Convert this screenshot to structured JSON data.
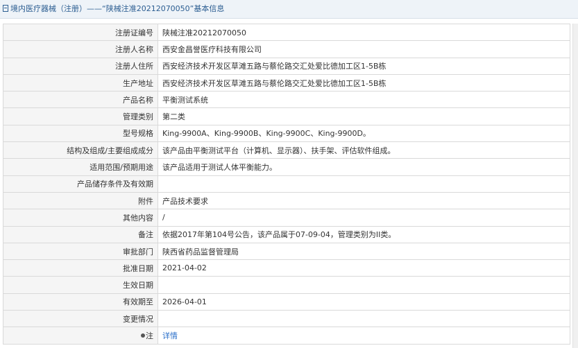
{
  "header": {
    "title": "境内医疗器械（注册）——“陕械注准20212070050”基本信息"
  },
  "rows": [
    {
      "label": "注册证编号",
      "value": "陕械注准20212070050"
    },
    {
      "label": "注册人名称",
      "value": "西安金昌誉医疗科技有限公司"
    },
    {
      "label": "注册人住所",
      "value": "西安经济技术开发区草滩五路与蔡伦路交汇处爱比德加工区1-5B栋"
    },
    {
      "label": "生产地址",
      "value": "西安经济技术开发区草滩五路与蔡伦路交汇处爱比德加工区1-5B栋"
    },
    {
      "label": "产品名称",
      "value": "平衡测试系统"
    },
    {
      "label": "管理类别",
      "value": "第二类"
    },
    {
      "label": "型号规格",
      "value": "King-9900A、King-9900B、King-9900C、King-9900D。"
    },
    {
      "label": "结构及组成/主要组成成分",
      "value": "该产品由平衡测试平台（计算机、显示器）、扶手架、评估软件组成。"
    },
    {
      "label": "适用范围/预期用途",
      "value": "该产品适用于测试人体平衡能力。"
    },
    {
      "label": "产品储存条件及有效期",
      "value": ""
    },
    {
      "label": "附件",
      "value": "产品技术要求"
    },
    {
      "label": "其他内容",
      "value": "/"
    },
    {
      "label": "备注",
      "value": "依据2017年第104号公告，该产品属于07-09-04，管理类别为II类。"
    },
    {
      "label": "审批部门",
      "value": "陕西省药品监督管理局"
    },
    {
      "label": "批准日期",
      "value": "2021-04-02"
    },
    {
      "label": "生效日期",
      "value": ""
    },
    {
      "label": "有效期至",
      "value": "2026-04-01"
    },
    {
      "label": "变更情况",
      "value": ""
    }
  ],
  "note_row": {
    "label": "注",
    "link": "详情"
  },
  "colors": {
    "title_text": "#2b5d91",
    "label_bg": "#f5f5f5",
    "border": "#d9d9d9",
    "link": "#2a6fc9"
  }
}
